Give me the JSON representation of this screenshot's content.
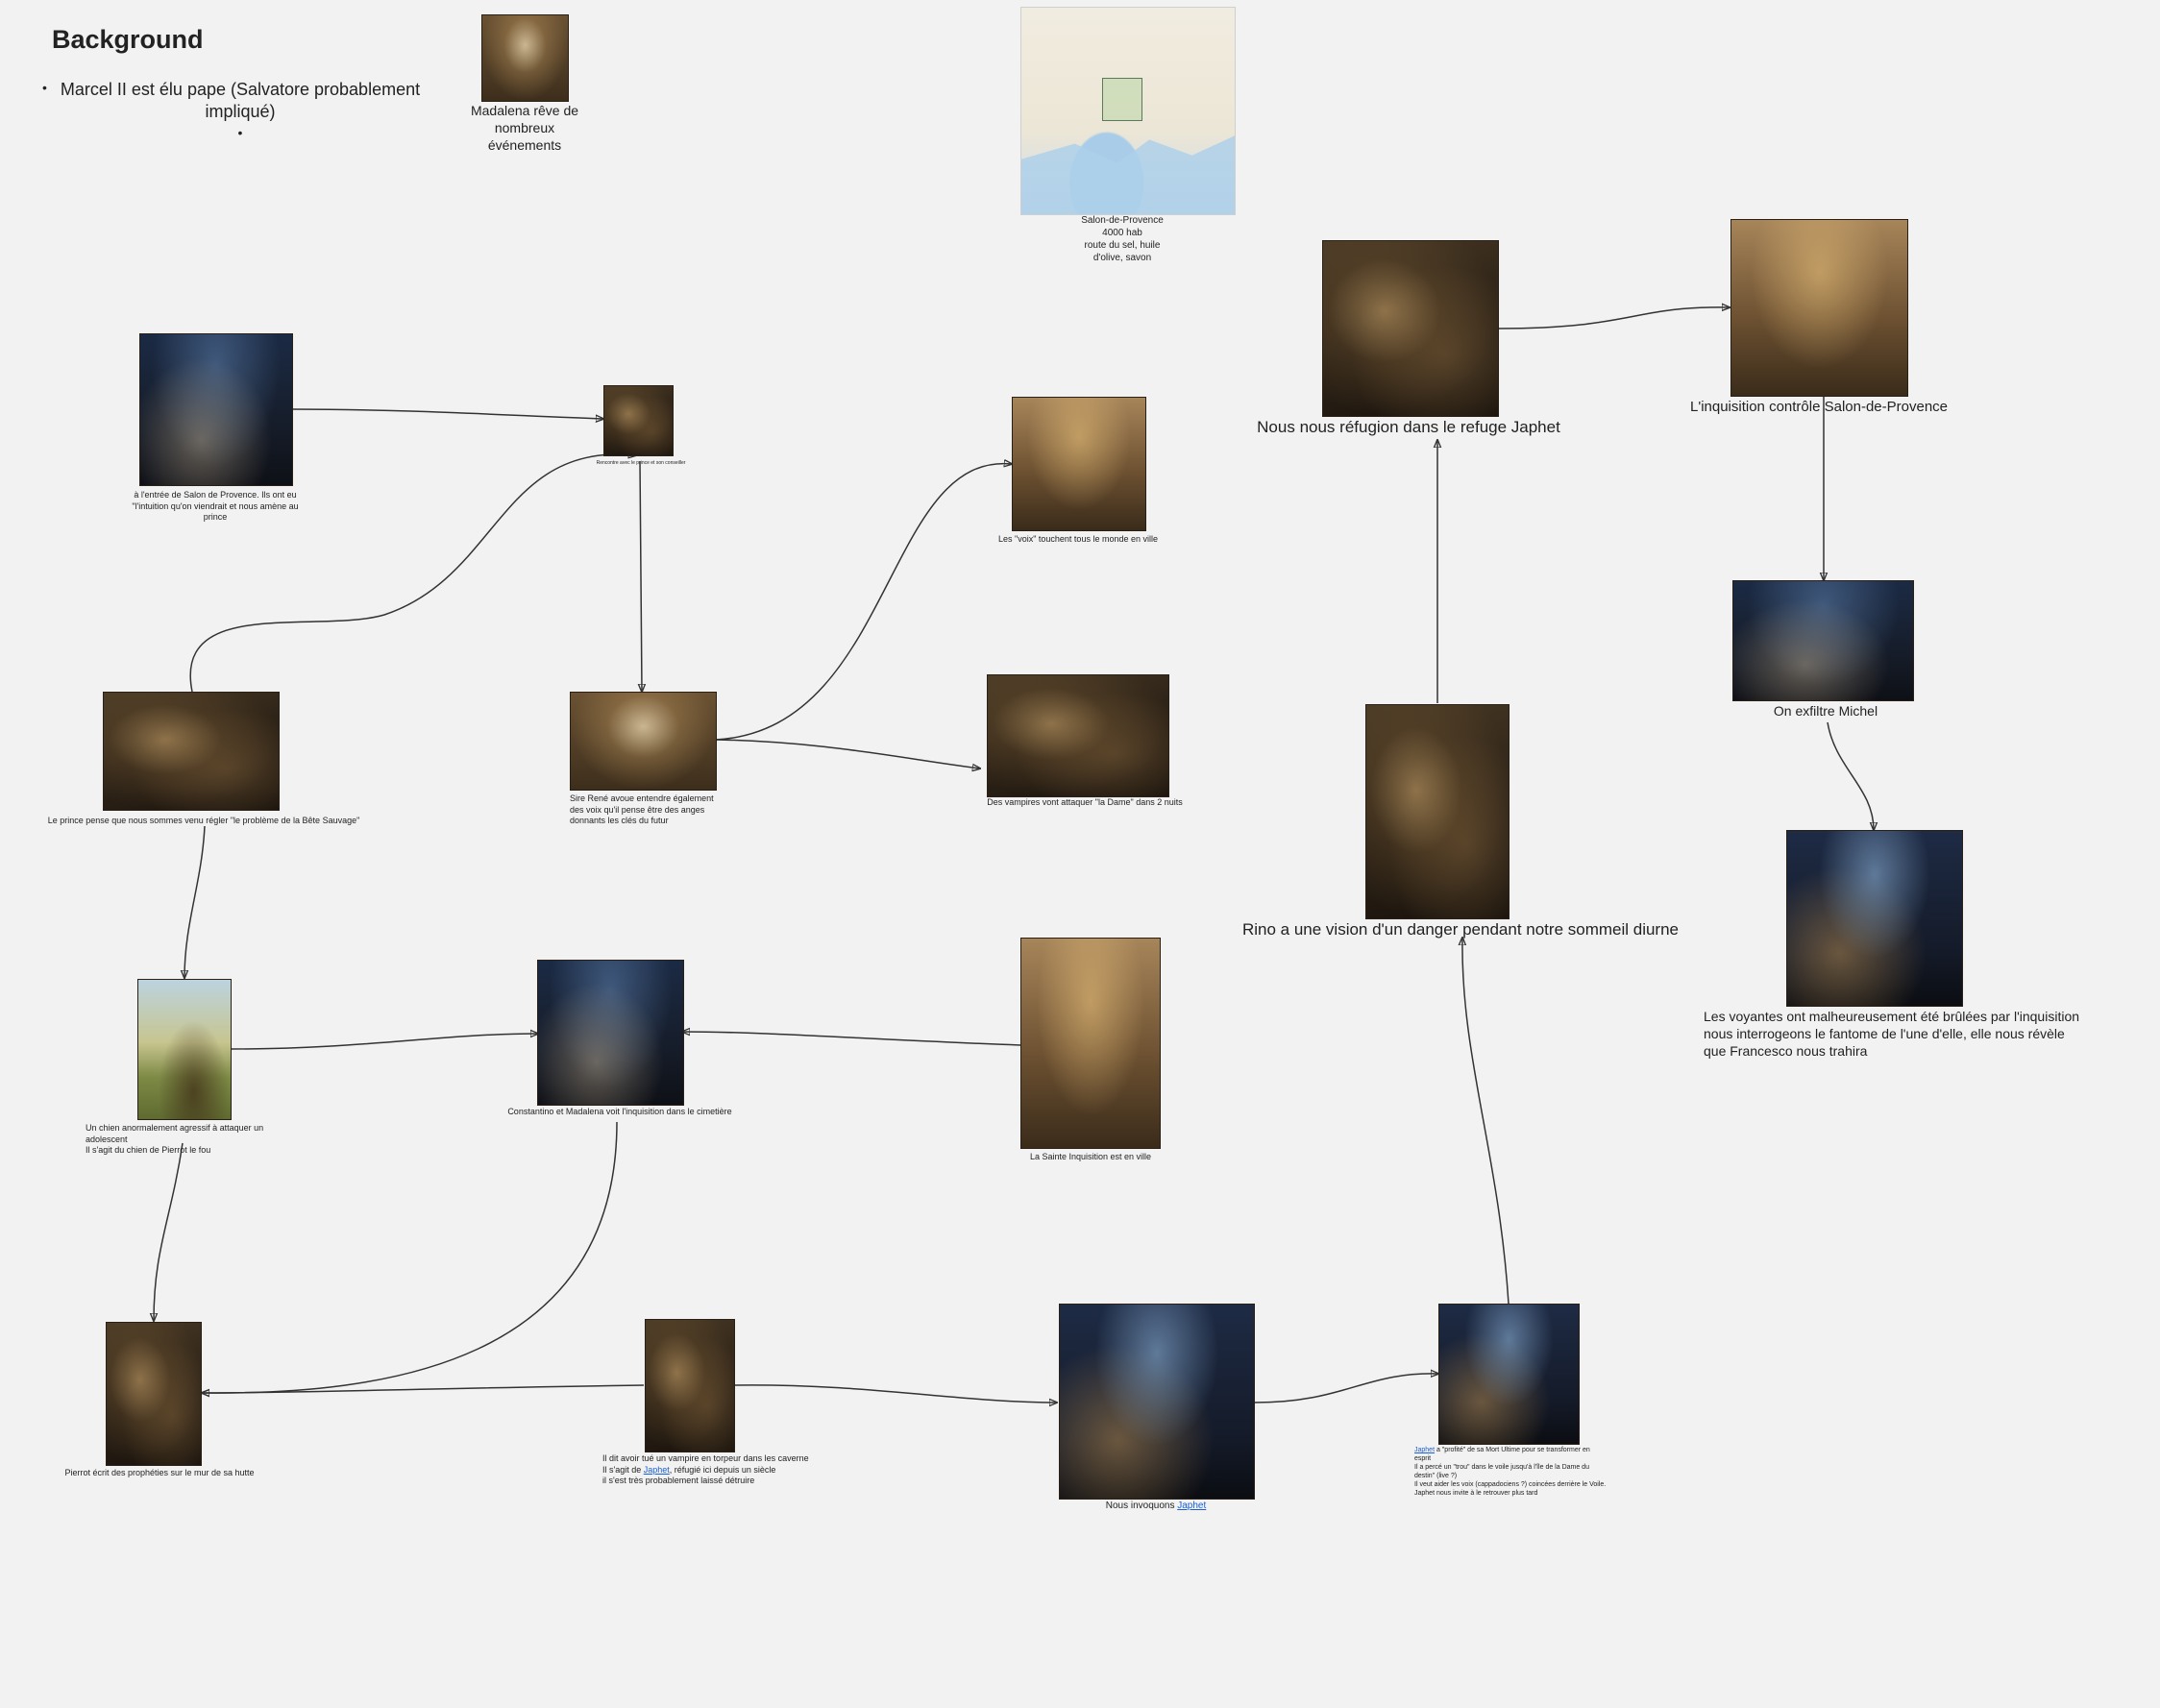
{
  "background": {
    "title": "Background",
    "bullets": [
      "Marcel II est élu pape (Salvatore probablement impliqué)",
      "•"
    ]
  },
  "nodes": {
    "madalena_reve": {
      "caption": "Madalena rêve de nombreux événements"
    },
    "salon_map": {
      "lines": [
        "Salon-de-Provence",
        "4000 hab",
        "route du sel, huile",
        "d'olive, savon"
      ]
    },
    "entree_salon": {
      "caption": "à l'entrée de Salon de Provence. Ils ont eu \"l'intuition qu'on viendrait et nous amène au prince"
    },
    "rencontre_prince": {
      "caption": "Rencontre avec le prince et son conseiller"
    },
    "voix_ville": {
      "caption": "Les \"voix\" touchent tous le monde en ville"
    },
    "refuge_japhet": {
      "caption": "Nous nous réfugion dans le refuge Japhet"
    },
    "inquisition_controle": {
      "caption": "L'inquisition contrôle Salon-de-Provence"
    },
    "prince_bete": {
      "caption": "Le prince pense que nous sommes venu régler \"le problème de la Bête Sauvage\""
    },
    "sire_rene": {
      "caption": "Sire René avoue entendre également des voix qu'il pense être des anges donnants les clés du futur"
    },
    "vampires_dame": {
      "caption": "Des vampires vont attaquer \"la Dame\" dans 2 nuits"
    },
    "exfiltre_michel": {
      "caption": "On exfiltre Michel"
    },
    "rino_vision": {
      "caption": "Rino a une vision d'un danger pendant notre sommeil diurne"
    },
    "voyantes": {
      "lines": [
        "Les voyantes ont malheureusement été brûlées par l'inquisition",
        "nous interrogeons le fantome de l'une d'elle, elle nous révèle",
        "que Francesco nous trahira"
      ]
    },
    "chien_agressif": {
      "lines": [
        "Un chien anormalement agressif à attaquer un adolescent",
        "Il s'agit du chien de Pierrot le fou"
      ]
    },
    "constantino": {
      "caption": "Constantino et Madalena voit l'inquisition dans le cimetière"
    },
    "sainte_inquisition": {
      "caption": "La Sainte Inquisition est en ville"
    },
    "pierrot": {
      "caption": "Pierrot écrit des prophéties sur le mur de sa hutte"
    },
    "vampire_torpeur": {
      "line1": "Il dit avoir tué un vampire en torpeur dans les caverne",
      "line2_pre": "Il s'agit de ",
      "line2_link": "Japhet",
      "line2_post": ", réfugié ici depuis un siècle",
      "line3": "il s'est très probablement laissé détruire"
    },
    "invoquons": {
      "pre": "Nous invoquons ",
      "link": "Japhet"
    },
    "japhet_profite": {
      "link": "Japhet",
      "line1_post": " a \"profité\" de sa Mort Ultime pour se transformer en esprit",
      "line2": "Il a percé un \"trou\" dans le voile jusqu'à l'île de la Dame du destin\" (live ?)",
      "line3": "Il veut aider les voix (cappadociens ?) coincées derrière le Voile.",
      "line4": "Japhet nous invite à le retrouver plus tard"
    }
  },
  "colors": {
    "background": "#f2f2f2",
    "edge": "#333333",
    "link": "#1a5fd6"
  }
}
